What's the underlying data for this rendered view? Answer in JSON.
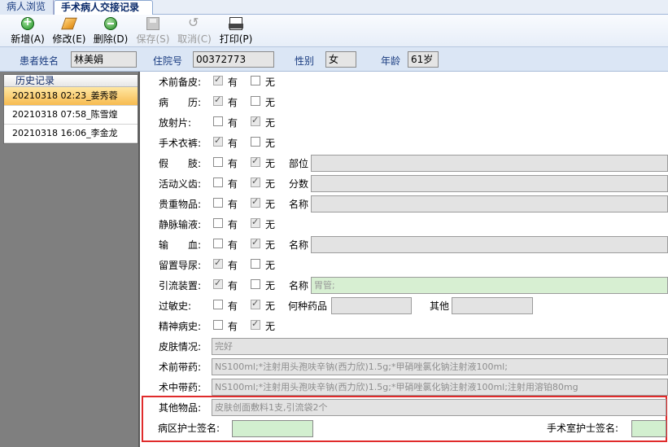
{
  "tabs": [
    {
      "label": "病人浏览",
      "active": false
    },
    {
      "label": "手术病人交接记录单",
      "active": true
    }
  ],
  "toolbar": {
    "add": "新增(A)",
    "edit": "修改(E)",
    "delete": "删除(D)",
    "save": "保存(S)",
    "cancel": "取消(C)",
    "print": "打印(P)"
  },
  "patient": {
    "name_label": "患者姓名",
    "name": "林美娟",
    "admit_label": "住院号",
    "admit_no": "00372773",
    "sex_label": "性别",
    "sex": "女",
    "age_label": "年龄",
    "age": "61岁"
  },
  "history": {
    "header": "历史记录",
    "items": [
      {
        "text": "20210318 02:23_姜秀蓉",
        "selected": true
      },
      {
        "text": "20210318 07:58_陈雪煌",
        "selected": false
      },
      {
        "text": "20210318 16:06_李金龙",
        "selected": false
      }
    ]
  },
  "options": {
    "yes": "有",
    "no": "无"
  },
  "form": {
    "prep_skin": {
      "label": "术前备皮:",
      "yes": true,
      "no": false
    },
    "medical_record": {
      "label": "病　　历:",
      "yes": true,
      "no": false
    },
    "xray": {
      "label": "放射片:",
      "yes": false,
      "no": true
    },
    "surgical_pants": {
      "label": "手术衣裤:",
      "yes": true,
      "no": false
    },
    "prosthesis": {
      "label": "假　　肢:",
      "yes": false,
      "no": true,
      "extra_label": "部位",
      "extra_value": ""
    },
    "dentures": {
      "label": "活动义齿:",
      "yes": false,
      "no": true,
      "extra_label": "分数",
      "extra_value": ""
    },
    "valuables": {
      "label": "贵重物品:",
      "yes": false,
      "no": true,
      "extra_label": "名称",
      "extra_value": ""
    },
    "iv_infusion": {
      "label": "静脉输液:",
      "yes": false,
      "no": true
    },
    "transfusion": {
      "label": "输　　血:",
      "yes": false,
      "no": true,
      "extra_label": "名称",
      "extra_value": ""
    },
    "catheter": {
      "label": "留置导尿:",
      "yes": true,
      "no": false
    },
    "drainage": {
      "label": "引流装置:",
      "yes": true,
      "no": false,
      "extra_label": "名称",
      "extra_value": "胃管;"
    },
    "allergy": {
      "label": "过敏史:",
      "yes": false,
      "no": true,
      "drug_label": "何种药品",
      "drug_value": "",
      "other_label": "其他",
      "other_value": ""
    },
    "psych": {
      "label": "精神病史:",
      "yes": false,
      "no": true
    },
    "skin_condition": {
      "label": "皮肤情况:",
      "value": "完好"
    },
    "preop_drugs": {
      "label": "术前带药:",
      "value": "NS100ml;*注射用头孢呋辛钠(西力欣)1.5g;*甲硝唑氯化钠注射液100ml;"
    },
    "intraop_drugs": {
      "label": "术中带药:",
      "value": "NS100ml;*注射用头孢呋辛钠(西力欣)1.5g;*甲硝唑氯化钠注射液100ml;注射用溶铂80mg"
    },
    "other_items": {
      "label": "其他物品:",
      "value": "皮肤创面敷料1支,引流袋2个"
    },
    "ward_nurse": {
      "label": "病区护士签名:",
      "value": ""
    },
    "or_nurse": {
      "label": "手术室护士签名:",
      "value": ""
    }
  },
  "colors": {
    "accent_blue": "#1a3c80",
    "selected_row": "#f7bb50",
    "highlight_box": "#e02b2b",
    "signature_field": "#d2efcf"
  }
}
